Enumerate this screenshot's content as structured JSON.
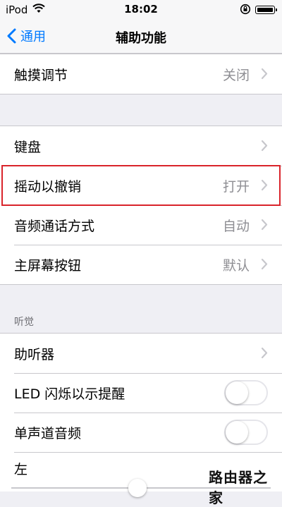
{
  "status_bar": {
    "carrier": "iPod",
    "time": "18:02",
    "icons": [
      "wifi-icon",
      "orientation-lock-icon",
      "battery-icon"
    ]
  },
  "nav": {
    "back_label": "通用",
    "title": "辅助功能"
  },
  "group1": {
    "touch": {
      "label": "触摸调节",
      "value": "关闭"
    }
  },
  "group2": {
    "keyboard": {
      "label": "键盘",
      "value": ""
    },
    "shake": {
      "label": "摇动以撤销",
      "value": "打开"
    },
    "call_audio": {
      "label": "音频通话方式",
      "value": "自动"
    },
    "home_button": {
      "label": "主屏幕按钮",
      "value": "默认"
    }
  },
  "hearing": {
    "header": "听觉",
    "hearing_aids": {
      "label": "助听器"
    },
    "led_flash": {
      "label": "LED 闪烁以示提醒",
      "enabled": false
    },
    "mono_audio": {
      "label": "单声道音频",
      "enabled": false
    },
    "balance": {
      "left_label": "左"
    }
  },
  "watermark": "路由器之家",
  "colors": {
    "accent": "#007aff",
    "highlight": "#d9242b",
    "secondary_text": "#8e8e93"
  }
}
